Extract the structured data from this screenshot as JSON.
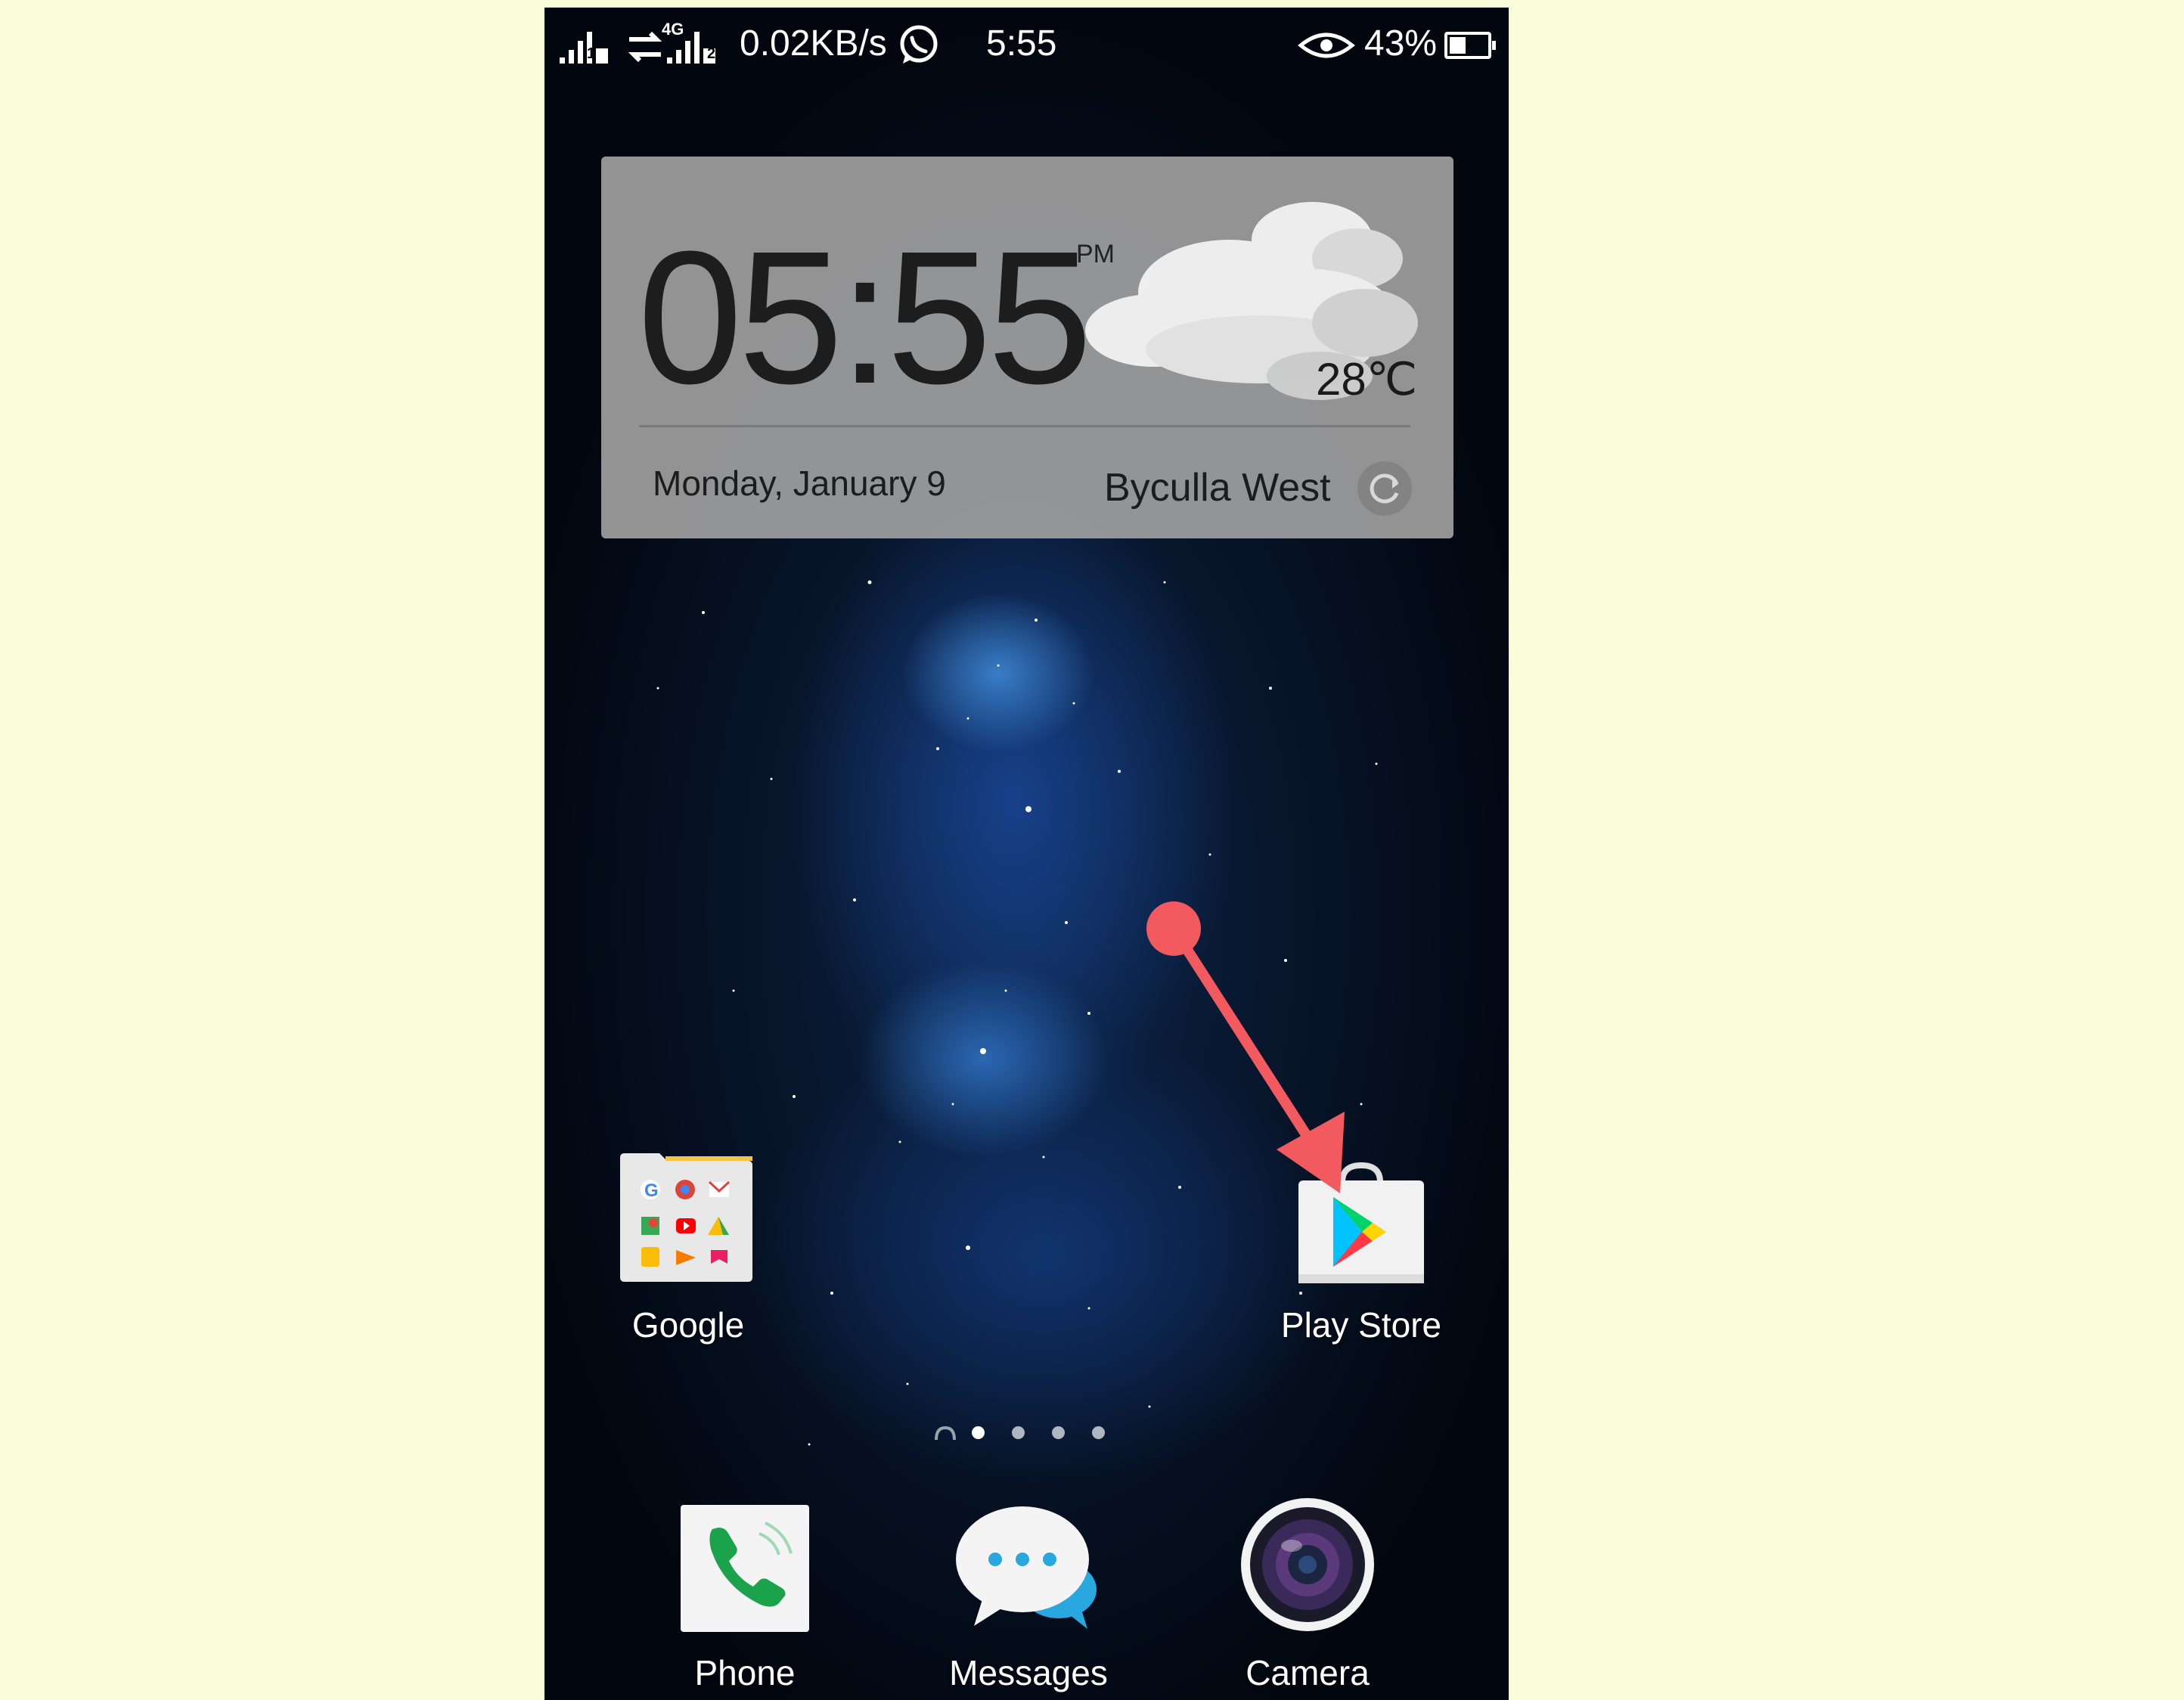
{
  "status_bar": {
    "network_type": "4G",
    "sim1": "1",
    "sim2": "2",
    "net_speed": "0.02KB/s",
    "time": "5:55",
    "battery_percent": "43%",
    "battery_level": 0.43,
    "icons": [
      "signal-sim1-icon",
      "data-transfer-icon",
      "signal-sim2-icon",
      "whatsapp-icon",
      "eye-comfort-icon",
      "battery-icon"
    ]
  },
  "clock_widget": {
    "time": "05:55",
    "ampm": "PM",
    "temperature": "28℃",
    "weather_icon": "cloudy-icon",
    "date": "Monday, January 9",
    "location": "Byculla West",
    "refresh_icon": "refresh-icon"
  },
  "home_apps": [
    {
      "label": "Google",
      "icon": "google-folder-icon"
    },
    {
      "label": "Play Store",
      "icon": "play-store-icon"
    }
  ],
  "page_indicator": {
    "count": 4,
    "active_index": 0
  },
  "dock": [
    {
      "label": "Phone",
      "icon": "phone-icon"
    },
    {
      "label": "Messages",
      "icon": "messages-icon"
    },
    {
      "label": "Camera",
      "icon": "camera-icon"
    }
  ],
  "annotation": {
    "color": "#f25a5f",
    "points_to": "Play Store"
  }
}
